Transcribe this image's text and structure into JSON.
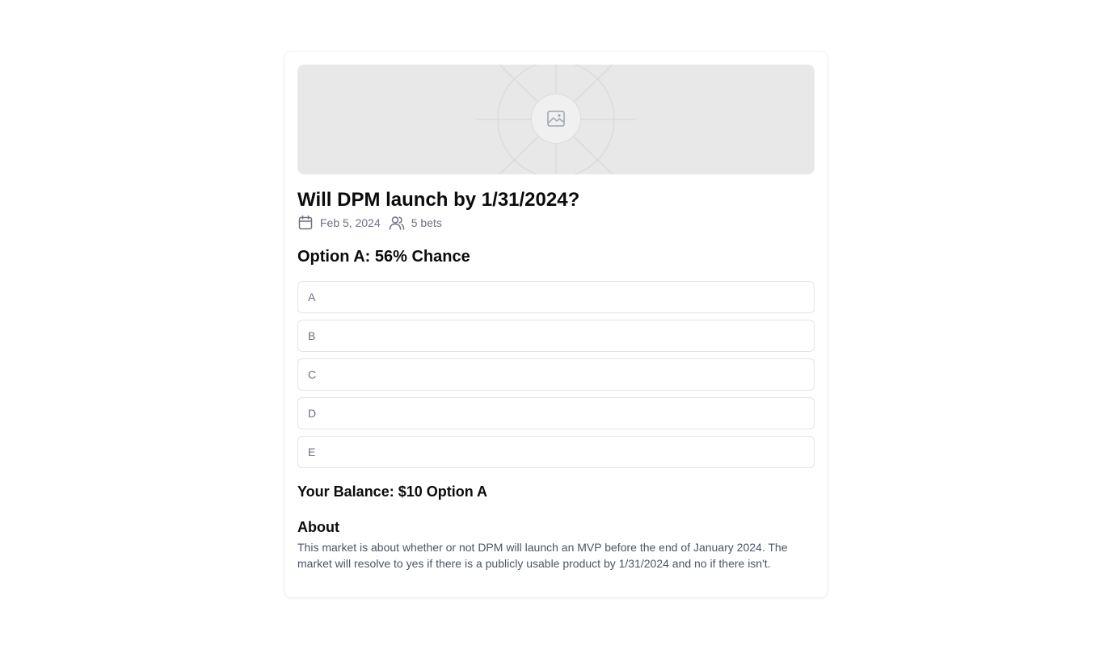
{
  "market": {
    "title": "Will DPM launch by 1/31/2024?",
    "date": "Feb 5, 2024",
    "bets": "5 bets",
    "chance": "Option A: 56% Chance"
  },
  "options": [
    {
      "label": "A"
    },
    {
      "label": "B"
    },
    {
      "label": "C"
    },
    {
      "label": "D"
    },
    {
      "label": "E"
    }
  ],
  "balance": "Your Balance: $10 Option A",
  "about": {
    "heading": "About",
    "text": "This market is about whether or not DPM will launch an MVP before the end of January 2024. The market will resolve to yes if there is a publicly usable product by 1/31/2024 and no if there isn't."
  },
  "icons": {
    "hero": "image-placeholder-icon",
    "date": "calendar-icon",
    "bets": "users-icon"
  },
  "colors": {
    "hero_bg": "#e8e8e8",
    "muted_text": "#6b7280",
    "border": "#e2e4e8"
  }
}
